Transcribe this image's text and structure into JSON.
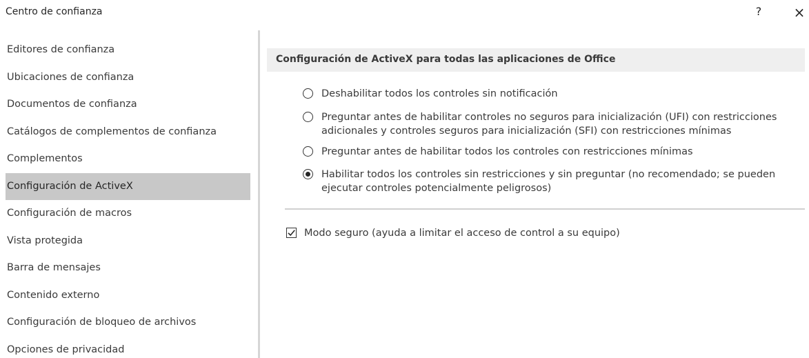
{
  "window": {
    "title": "Centro de confianza",
    "help_label": "?",
    "close_label": "×"
  },
  "sidebar": {
    "items": [
      {
        "label": "Editores de confianza"
      },
      {
        "label": "Ubicaciones de confianza"
      },
      {
        "label": "Documentos de confianza"
      },
      {
        "label": "Catálogos de complementos de confianza"
      },
      {
        "label": "Complementos"
      },
      {
        "label": "Configuración de ActiveX",
        "selected": true
      },
      {
        "label": "Configuración de macros"
      },
      {
        "label": "Vista protegida"
      },
      {
        "label": "Barra de mensajes"
      },
      {
        "label": "Contenido externo"
      },
      {
        "label": "Configuración de bloqueo de archivos"
      },
      {
        "label": "Opciones de privacidad"
      }
    ]
  },
  "main": {
    "section_title": "Configuración de ActiveX para todas las aplicaciones de Office",
    "options": [
      {
        "label": "Deshabilitar todos los controles sin notificación",
        "selected": false
      },
      {
        "label": "Preguntar antes de habilitar controles no seguros para inicialización (UFI) con restricciones\nadicionales y controles seguros para inicialización (SFI) con restricciones mínimas",
        "selected": false
      },
      {
        "label": "Preguntar antes de habilitar todos los controles con restricciones mínimas",
        "selected": false
      },
      {
        "label": "Habilitar todos los controles sin restricciones y sin preguntar (no recomendado; se pueden\nejecutar controles potencialmente peligrosos)",
        "selected": true
      }
    ],
    "safe_mode": {
      "label": "Modo seguro (ayuda a limitar el acceso de control a su equipo)",
      "checked": true
    }
  }
}
